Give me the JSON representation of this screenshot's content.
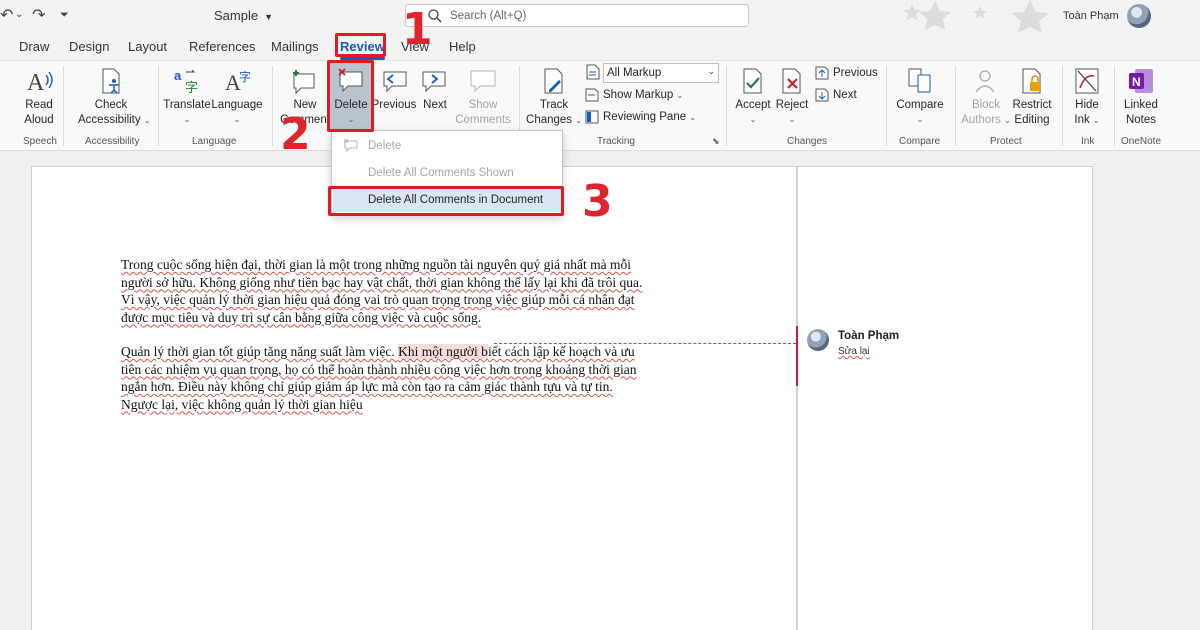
{
  "titlebar": {
    "doc_title": "Sample",
    "search_placeholder": "Search (Alt+Q)",
    "user_name": "Toàn Phạm"
  },
  "menu": {
    "tabs": [
      "Draw",
      "Design",
      "Layout",
      "References",
      "Mailings",
      "Review",
      "View",
      "Help"
    ],
    "active_tab": "Review"
  },
  "ribbon": {
    "speech": {
      "group": "Speech",
      "read_aloud": [
        "Read",
        "Aloud"
      ]
    },
    "accessibility": {
      "group": "Accessibility",
      "check": [
        "Check",
        "Accessibility"
      ]
    },
    "language": {
      "group": "Language",
      "translate": "Translate",
      "language": "Language"
    },
    "comments": {
      "new": [
        "New",
        "Comment"
      ],
      "delete": "Delete",
      "previous": "Previous",
      "next": "Next",
      "show": [
        "Show",
        "Comments"
      ]
    },
    "tracking": {
      "group": "Tracking",
      "track": [
        "Track",
        "Changes"
      ],
      "markup_value": "All Markup",
      "show_markup": "Show Markup",
      "reviewing_pane": "Reviewing Pane"
    },
    "changes": {
      "group": "Changes",
      "accept": "Accept",
      "reject": "Reject",
      "previous": "Previous",
      "next": "Next"
    },
    "compare": {
      "group": "Compare",
      "compare": "Compare"
    },
    "protect": {
      "group": "Protect",
      "block": [
        "Block",
        "Authors"
      ],
      "restrict": [
        "Restrict",
        "Editing"
      ]
    },
    "ink": {
      "group": "Ink",
      "hide": [
        "Hide",
        "Ink"
      ]
    },
    "onenote": {
      "group": "OneNote",
      "linked": [
        "Linked",
        "Notes"
      ]
    }
  },
  "delete_menu": {
    "items": [
      "Delete",
      "Delete All Comments Shown",
      "Delete All Comments in Document"
    ]
  },
  "document": {
    "para1": [
      "Trong cuộc sống hiện đại, thời gian là một trong những nguồn tài nguyên quý giá nhất mà mỗi",
      "người sở hữu. Không giống như tiền bạc hay vật chất, thời gian không thể lấy lại khi đã trôi qua.",
      "Vì vậy, việc quản lý thời gian hiệu quả đóng vai trò quan trọng trong việc giúp mỗi cá nhân đạt",
      "được mục tiêu và duy trì sự cân bằng giữa công việc và cuộc sống."
    ],
    "para2_line1_pre": "Quản lý thời gian tốt giúp tăng năng suất làm việc. ",
    "para2_highlight": "Khi một người b",
    "para2_line1_post": "iết cách lập kế hoạch và ưu",
    "para2_rest": [
      "tiên các nhiệm vụ quan trọng, họ có thể hoàn thành nhiều công việc hơn trong khoảng thời gian",
      "ngắn hơn. Điều này không chỉ giúp giảm áp lực mà còn tạo ra cảm giác thành tựu và tự tin.",
      "Ngược lại, việc không quản lý thời gian hiệu"
    ]
  },
  "comment": {
    "author": "Toàn Phạm",
    "text": "Sửa lại"
  },
  "annotations": {
    "step1": "1",
    "step2": "2",
    "step3": "3"
  },
  "colors": {
    "accent": "#185abd",
    "annotation_red": "#e01b24",
    "hover": "#dbe6f4"
  }
}
